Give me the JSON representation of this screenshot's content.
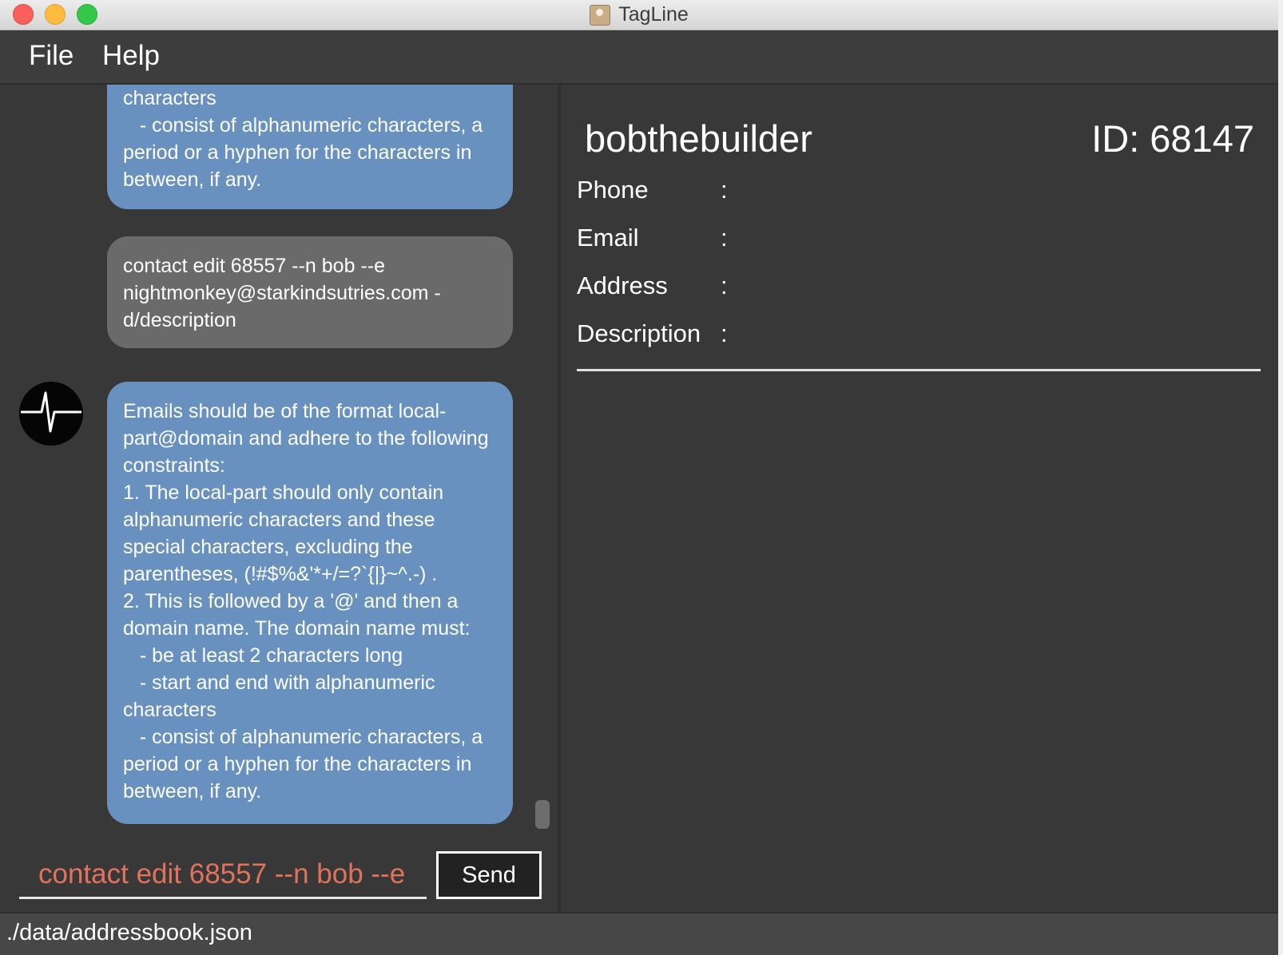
{
  "window": {
    "title": "TagLine"
  },
  "menu": {
    "file": "File",
    "help": "Help"
  },
  "chat": {
    "messages": [
      {
        "sender": "bot",
        "text": "characters\n   - consist of alphanumeric characters, a period or a hyphen for the characters in between, if any."
      },
      {
        "sender": "user",
        "text": "contact edit 68557 --n bob --e nightmonkey@starkindsutries.com -d/description"
      },
      {
        "sender": "bot",
        "text": "Emails should be of the format local-part@domain and adhere to the following constraints:\n1. The local-part should only contain alphanumeric characters and these special characters, excluding the parentheses, (!#$%&'*+/=?`{|}~^.-) .\n2. This is followed by a '@' and then a domain name. The domain name must:\n   - be at least 2 characters long\n   - start and end with alphanumeric characters\n   - consist of alphanumeric characters, a period or a hyphen for the characters in between, if any."
      }
    ],
    "avatar_icon": "pulse-icon"
  },
  "command": {
    "value": "contact edit 68557 --n bob --e nightmonkey@starkindsutries.com -d/description",
    "send_label": "Send"
  },
  "contact": {
    "name": "bobthebuilder",
    "id_label": "ID: 68147",
    "fields": [
      {
        "label": "Phone",
        "colon": ":",
        "value": ""
      },
      {
        "label": "Email",
        "colon": ":",
        "value": ""
      },
      {
        "label": "Address",
        "colon": ":",
        "value": ""
      },
      {
        "label": "Description",
        "colon": ":",
        "value": ""
      }
    ]
  },
  "status": {
    "path": "./data/addressbook.json"
  },
  "colors": {
    "bot_bubble": "#6891c0",
    "user_bubble": "#6a6a6a",
    "command_text": "#e2735b",
    "background": "#383838"
  }
}
